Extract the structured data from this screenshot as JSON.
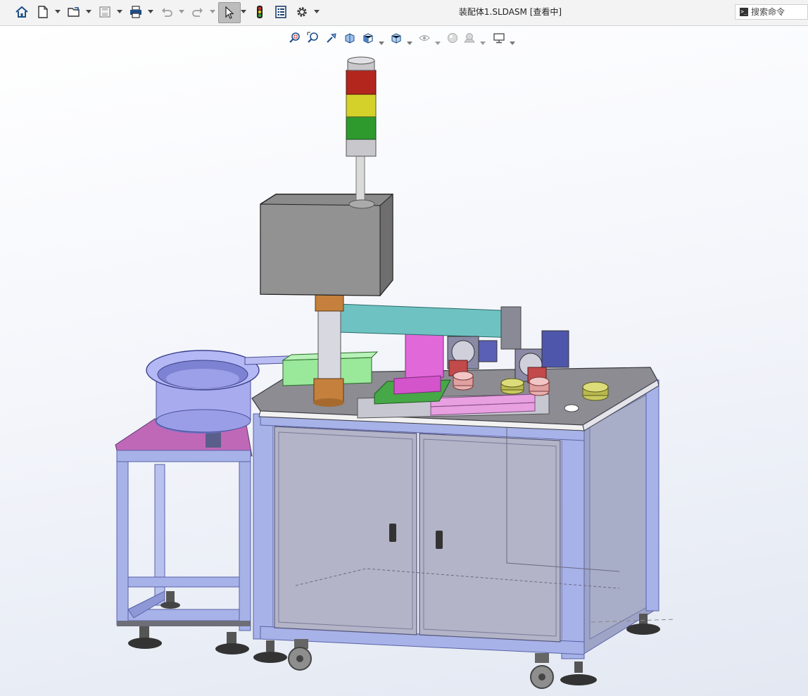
{
  "window": {
    "title": "装配体1.SLDASM [查看中]"
  },
  "toolbar": {
    "buttons": [
      {
        "name": "home-button",
        "icon": "home-icon"
      },
      {
        "name": "new-document-button",
        "icon": "new-document-icon"
      },
      {
        "name": "open-button",
        "icon": "open-folder-icon"
      },
      {
        "name": "save-button",
        "icon": "save-icon"
      },
      {
        "name": "print-button",
        "icon": "print-icon"
      },
      {
        "name": "undo-button",
        "icon": "undo-icon"
      },
      {
        "name": "redo-button",
        "icon": "redo-icon"
      },
      {
        "name": "select-button",
        "icon": "cursor-arrow-icon",
        "active": true
      },
      {
        "name": "rebuild-button",
        "icon": "traffic-light-icon"
      },
      {
        "name": "file-properties-button",
        "icon": "file-properties-icon"
      },
      {
        "name": "options-button",
        "icon": "gear-icon"
      }
    ]
  },
  "search": {
    "placeholder": "搜索命令",
    "icon": "command-prompt-icon"
  },
  "heads_up_toolbar": {
    "tools": [
      {
        "name": "zoom-to-fit",
        "icon": "zoom-fit-icon"
      },
      {
        "name": "zoom-to-area",
        "icon": "zoom-area-icon"
      },
      {
        "name": "previous-view",
        "icon": "previous-view-icon"
      },
      {
        "name": "section-view",
        "icon": "section-view-icon"
      },
      {
        "name": "view-orientation",
        "icon": "view-orientation-icon"
      },
      {
        "name": "display-style",
        "icon": "display-style-icon"
      },
      {
        "name": "hide-show-items",
        "icon": "hide-show-icon"
      },
      {
        "name": "edit-appearance",
        "icon": "appearance-icon"
      },
      {
        "name": "apply-scene",
        "icon": "scene-icon"
      },
      {
        "name": "view-settings",
        "icon": "monitor-icon"
      }
    ]
  },
  "colors": {
    "frame": "#a7b2e8",
    "frame_dark": "#5862a8",
    "panel": "#b4b4c8",
    "tabletop": "#8c8c92",
    "light_red": "#b3261e",
    "light_yellow": "#d4d22a",
    "light_green": "#2e9a2e",
    "control_box": "#8b8b8b",
    "bracket_magenta": "#e068d8",
    "beam_teal": "#6fc2c2",
    "feeder_bowl": "#a8acef",
    "stand_top_pink": "#c068b8",
    "slide_green": "#9ae89a",
    "copper": "#c4803c"
  }
}
